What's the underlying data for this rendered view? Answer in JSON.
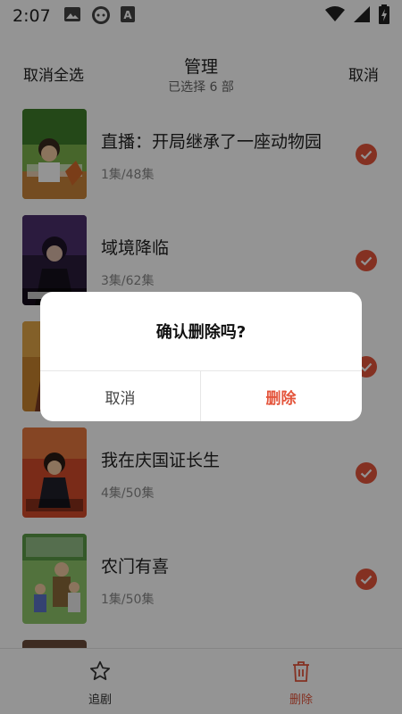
{
  "status_bar": {
    "time": "2:07",
    "left_icons": [
      "image-icon",
      "android-head-icon",
      "font-a-icon"
    ],
    "right_icons": [
      "wifi-icon",
      "signal-icon",
      "battery-icon"
    ]
  },
  "header": {
    "left_action": "取消全选",
    "title": "管理",
    "subtitle": "已选择 6 部",
    "right_action": "取消"
  },
  "items": [
    {
      "title": "直播：开局继承了一座动物园",
      "meta": "1集/48集",
      "selected": true
    },
    {
      "title": "域境降临",
      "meta": "3集/62集",
      "selected": true
    },
    {
      "title": "",
      "meta": "",
      "selected": true
    },
    {
      "title": "我在庆国证长生",
      "meta": "4集/50集",
      "selected": true
    },
    {
      "title": "农门有喜",
      "meta": "1集/50集",
      "selected": true
    }
  ],
  "bottom_bar": {
    "follow_label": "追剧",
    "delete_label": "删除"
  },
  "dialog": {
    "message": "确认删除吗?",
    "cancel_label": "取消",
    "confirm_label": "删除"
  },
  "colors": {
    "accent": "#e4553c",
    "overlay": "rgba(0,0,0,0.42)",
    "text_primary": "#222222",
    "text_secondary": "#888888"
  }
}
